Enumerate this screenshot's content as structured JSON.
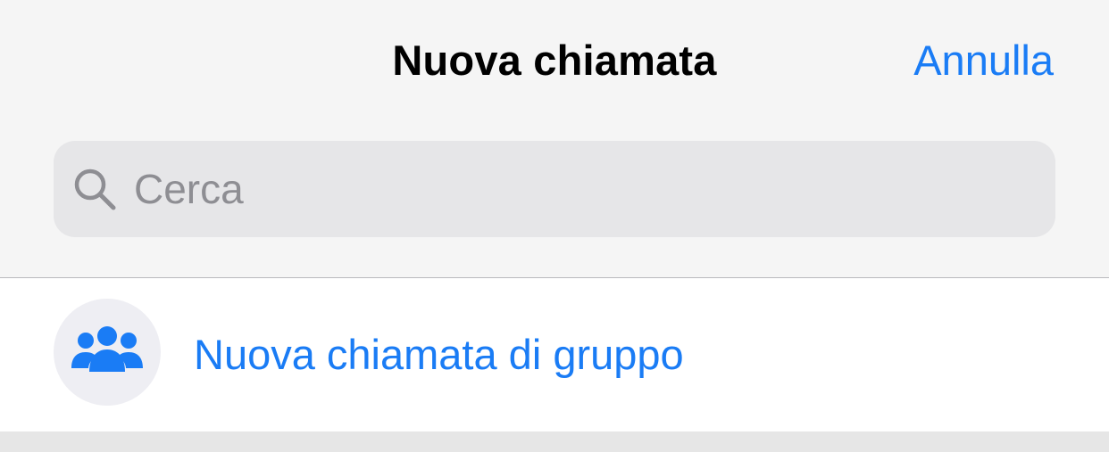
{
  "header": {
    "title": "Nuova chiamata",
    "cancel_label": "Annulla"
  },
  "search": {
    "placeholder": "Cerca",
    "value": "",
    "icon": "magnifying-glass"
  },
  "actions": [
    {
      "label": "Nuova chiamata di gruppo",
      "icon": "group-people"
    }
  ],
  "colors": {
    "accent": "#1a7cf5",
    "background": "#f5f5f5",
    "search_field": "#e6e6e8",
    "avatar_bg": "#eeeef3"
  }
}
